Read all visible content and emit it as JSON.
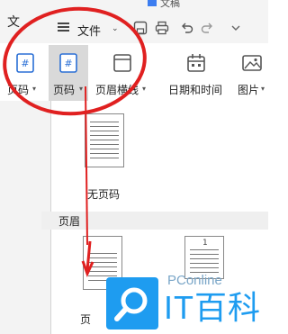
{
  "title_bar": {
    "left_tab_partial": "文",
    "top_strip_text": "文稿"
  },
  "menu": {
    "file_label": "文件",
    "file_caret": "⌄"
  },
  "quick_access": {
    "save_icon": "save-icon",
    "print_icon": "print-icon",
    "undo_icon": "undo-icon",
    "redo_icon": "redo-icon",
    "more_icon": "more-icon"
  },
  "ribbon": {
    "items": [
      {
        "label": "页码",
        "caret": "▾",
        "icon": "page-number-icon"
      },
      {
        "label": "页码",
        "caret": "▾",
        "icon": "page-number-icon",
        "active": true
      },
      {
        "label": "页眉横线",
        "caret": "▾",
        "icon": "header-line-icon"
      },
      {
        "label": "日期和时间",
        "icon": "calendar-icon"
      },
      {
        "label": "图片",
        "caret": "▾",
        "icon": "picture-icon"
      }
    ]
  },
  "dropdown": {
    "no_page_number_label": "无页码",
    "section_header": "页眉",
    "header_number_mark": "1",
    "partial_label": "页"
  },
  "watermark": {
    "brand": "PConline",
    "name": "IT百科"
  },
  "colors": {
    "annotation_red": "#e02020",
    "watermark_blue": "#1e9cf0",
    "active_button_bg": "#d9d9d9"
  }
}
